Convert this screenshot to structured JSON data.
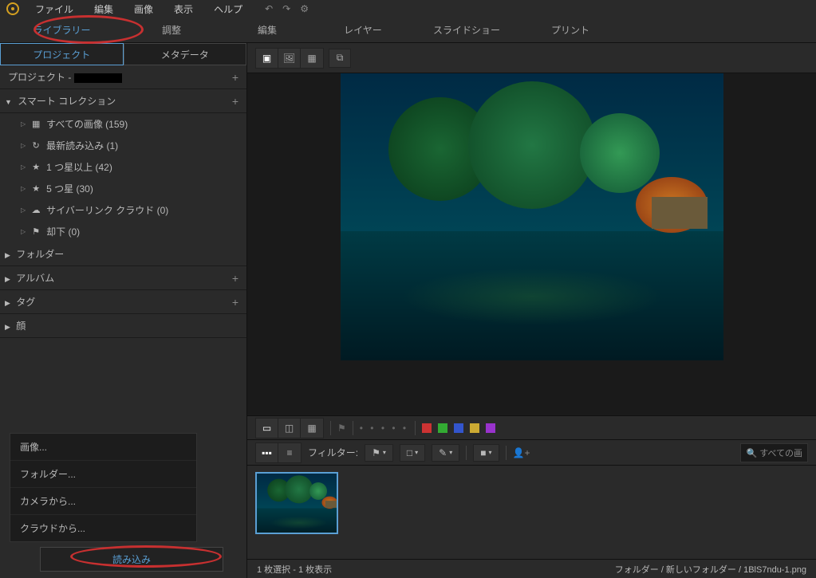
{
  "menubar": {
    "file": "ファイル",
    "edit": "編集",
    "image": "画像",
    "view": "表示",
    "help": "ヘルプ"
  },
  "modules": {
    "library": "ライブラリー",
    "adjust": "調整",
    "edit": "編集",
    "layer": "レイヤー",
    "slideshow": "スライドショー",
    "print": "プリント"
  },
  "side_tabs": {
    "project": "プロジェクト",
    "metadata": "メタデータ"
  },
  "sidebar": {
    "project_label": "プロジェクト - ",
    "smart_collection": "スマート コレクション",
    "items": [
      {
        "label": "すべての画像 (159)",
        "glyph": "▦"
      },
      {
        "label": "最新読み込み (1)",
        "glyph": "↻"
      },
      {
        "label": "1 つ星以上 (42)",
        "glyph": "★"
      },
      {
        "label": "5 つ星 (30)",
        "glyph": "★"
      },
      {
        "label": "サイバーリンク クラウド (0)",
        "glyph": "☁"
      },
      {
        "label": "却下 (0)",
        "glyph": "⚑"
      }
    ],
    "folder": "フォルダー",
    "album": "アルバム",
    "tag": "タグ",
    "face": "顔"
  },
  "context_menu": {
    "image": "画像...",
    "folder": "フォルダー...",
    "camera": "カメラから...",
    "cloud": "クラウドから..."
  },
  "import_label": "読み込み",
  "filter_label": "フィルター:",
  "search_label": "すべての画",
  "status": {
    "selection": "1 枚選択 - 1 枚表示",
    "breadcrumb": "フォルダー / 新しいフォルダー / 1BlS7ndu-1.png"
  },
  "colors": {
    "swatches": [
      "#cc3333",
      "#33aa33",
      "#3355cc",
      "#ccaa33",
      "#9933cc"
    ]
  }
}
